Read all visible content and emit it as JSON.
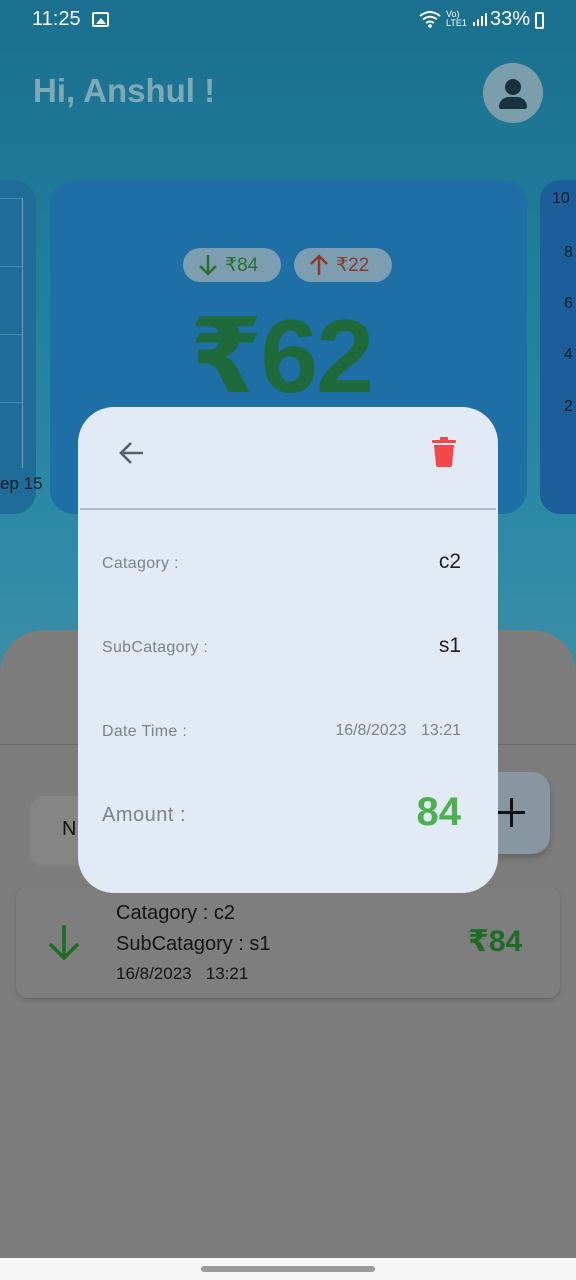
{
  "status_bar": {
    "time": "11:25",
    "network_label": "Vo) LTE1",
    "battery": "33%"
  },
  "header": {
    "greeting": "Hi, Anshul !",
    "avatar_icon": "person-icon"
  },
  "summary_card": {
    "income": "₹84",
    "expense": "₹22",
    "balance": "₹62",
    "income_icon": "arrow-down-icon",
    "expense_icon": "arrow-up-icon"
  },
  "left_chart": {
    "x_label": "ep 15"
  },
  "right_chart": {
    "y_labels": [
      "10",
      "8",
      "6",
      "4",
      "2"
    ]
  },
  "filter_chip": {
    "label": "N"
  },
  "add_button_icon": "plus-icon",
  "transaction": {
    "category": "Catagory : c2",
    "subcategory": "SubCatagory : s1",
    "datetime": "16/8/2023   13:21",
    "amount": "₹84",
    "icon": "arrow-down-icon"
  },
  "dialog": {
    "back_icon": "arrow-left-icon",
    "delete_icon": "trash-icon",
    "category_label": "Catagory :",
    "category_value": "c2",
    "subcategory_label": "SubCatagory :",
    "subcategory_value": "s1",
    "datetime_label": "Date Time :",
    "date_value": "16/8/2023",
    "time_value": "13:21",
    "amount_label": "Amount :",
    "amount_value": "84"
  },
  "colors": {
    "income_green": "#4caf50",
    "delete_red": "#f44848",
    "dialog_bg": "#e2ebf5"
  }
}
